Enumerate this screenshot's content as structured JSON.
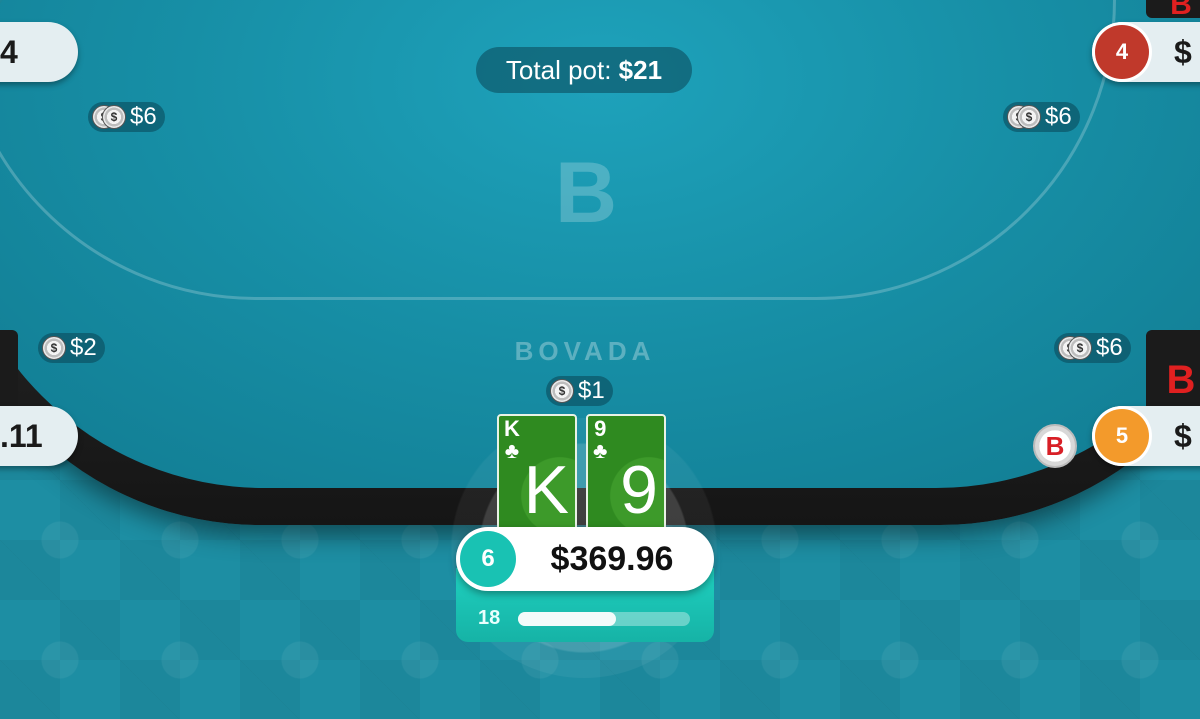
{
  "table": {
    "pot_label": "Total pot:",
    "pot_amount": "$21",
    "logo_letter": "B",
    "brand_name": "BOVADA",
    "felt_color": "#178fa6"
  },
  "bets": [
    {
      "label": "$6"
    },
    {
      "label": "$6"
    },
    {
      "label": "$2"
    },
    {
      "label": "$6"
    },
    {
      "label": "$1"
    }
  ],
  "chip_glyph": "$",
  "seats": {
    "top_left": {
      "stack": "4"
    },
    "top_right": {
      "seat_number": "4",
      "stack": "$",
      "badge_color": "#c0392b",
      "avatar_logo": "B"
    },
    "mid_left": {
      "stack": ".11"
    },
    "mid_right": {
      "seat_number": "5",
      "stack": "$",
      "badge_color": "#f39a2b",
      "avatar_logo": "B"
    }
  },
  "dealer_button": {
    "label": "B"
  },
  "hero": {
    "seat_number": "6",
    "stack": "$369.96",
    "cards": [
      {
        "rank": "K",
        "suit": "♣"
      },
      {
        "rank": "9",
        "suit": "♣"
      }
    ],
    "timer_seconds": "18",
    "timer_progress": 0.57,
    "accent_color": "#19c2b3"
  }
}
